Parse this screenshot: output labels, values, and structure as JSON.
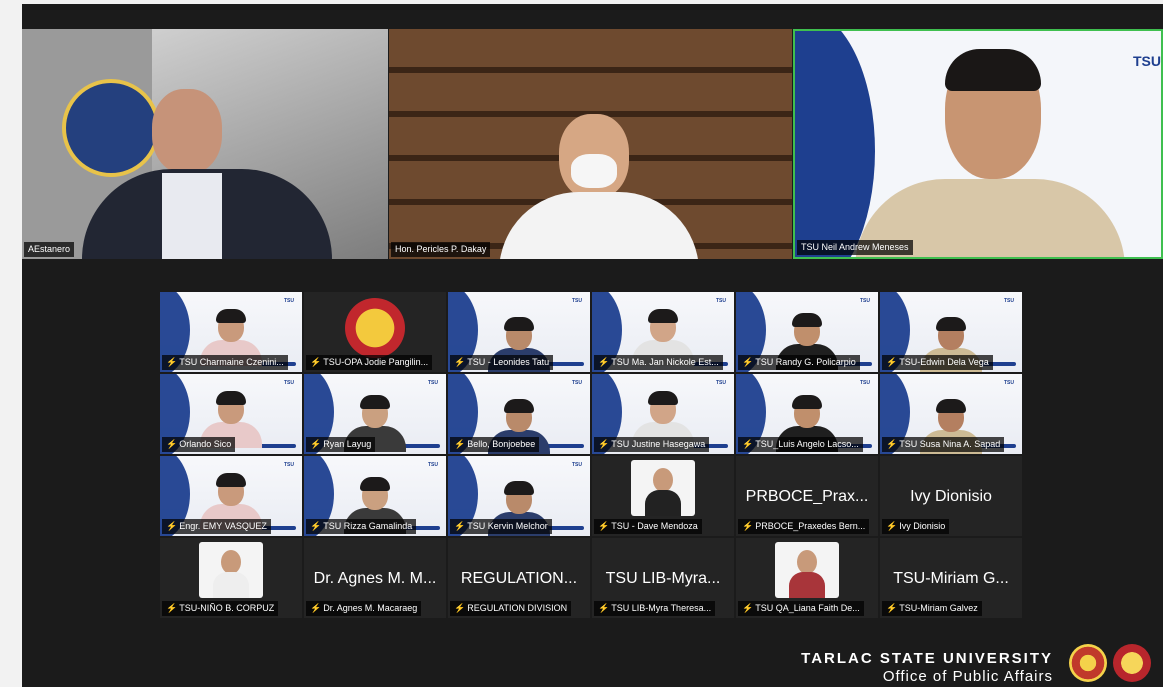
{
  "top_row": [
    {
      "name": "AEstanero"
    },
    {
      "name": "Hon. Pericles P. Dakay"
    },
    {
      "name": "TSU Neil Andrew Meneses"
    }
  ],
  "gallery": [
    {
      "name": "TSU Charmaine Czenini..."
    },
    {
      "name": "TSU-OPA Jodie Pangilin..."
    },
    {
      "name": "TSU - Leonides Tatu"
    },
    {
      "name": "TSU Ma. Jan Nickole Est..."
    },
    {
      "name": "TSU Randy G. Policarpio"
    },
    {
      "name": "TSU-Edwin Dela Vega"
    },
    {
      "name": "Orlando Sico"
    },
    {
      "name": "Ryan Layug"
    },
    {
      "name": "Bello, Bonjoebee"
    },
    {
      "name": "TSU Justine Hasegawa"
    },
    {
      "name": "TSU_Luis Angelo Lacso..."
    },
    {
      "name": "TSU Susa Nina A. Sapad"
    },
    {
      "name": "Engr. EMY VASQUEZ"
    },
    {
      "name": "TSU Rizza Gamalinda"
    },
    {
      "name": "TSU Kervin Melchor"
    },
    {
      "name": "TSU - Dave Mendoza"
    },
    {
      "name": "PRBOCE_Praxedes Bern...",
      "display": "PRBOCE_Prax..."
    },
    {
      "name": "Ivy Dionisio",
      "display": "Ivy Dionisio"
    },
    {
      "name": "TSU-NIÑO B. CORPUZ"
    },
    {
      "name": "Dr. Agnes M. Macaraeg",
      "display": "Dr. Agnes M. M..."
    },
    {
      "name": "REGULATION DIVISION",
      "display": "REGULATION..."
    },
    {
      "name": "TSU LIB-Myra Theresa...",
      "display": "TSU LIB-Myra..."
    },
    {
      "name": "TSU QA_Liana Faith De..."
    },
    {
      "name": "TSU-Miriam Galvez",
      "display": "TSU-Miriam G..."
    }
  ],
  "watermark": {
    "line1": "TARLAC STATE UNIVERSITY",
    "line2": "Office of Public Affairs"
  },
  "colors": {
    "accent": "#1e3f8f",
    "mic_muted": "#e03a3a",
    "active_speaker": "#3fbf4f"
  },
  "icons": {
    "mic": "muted-mic-icon"
  }
}
